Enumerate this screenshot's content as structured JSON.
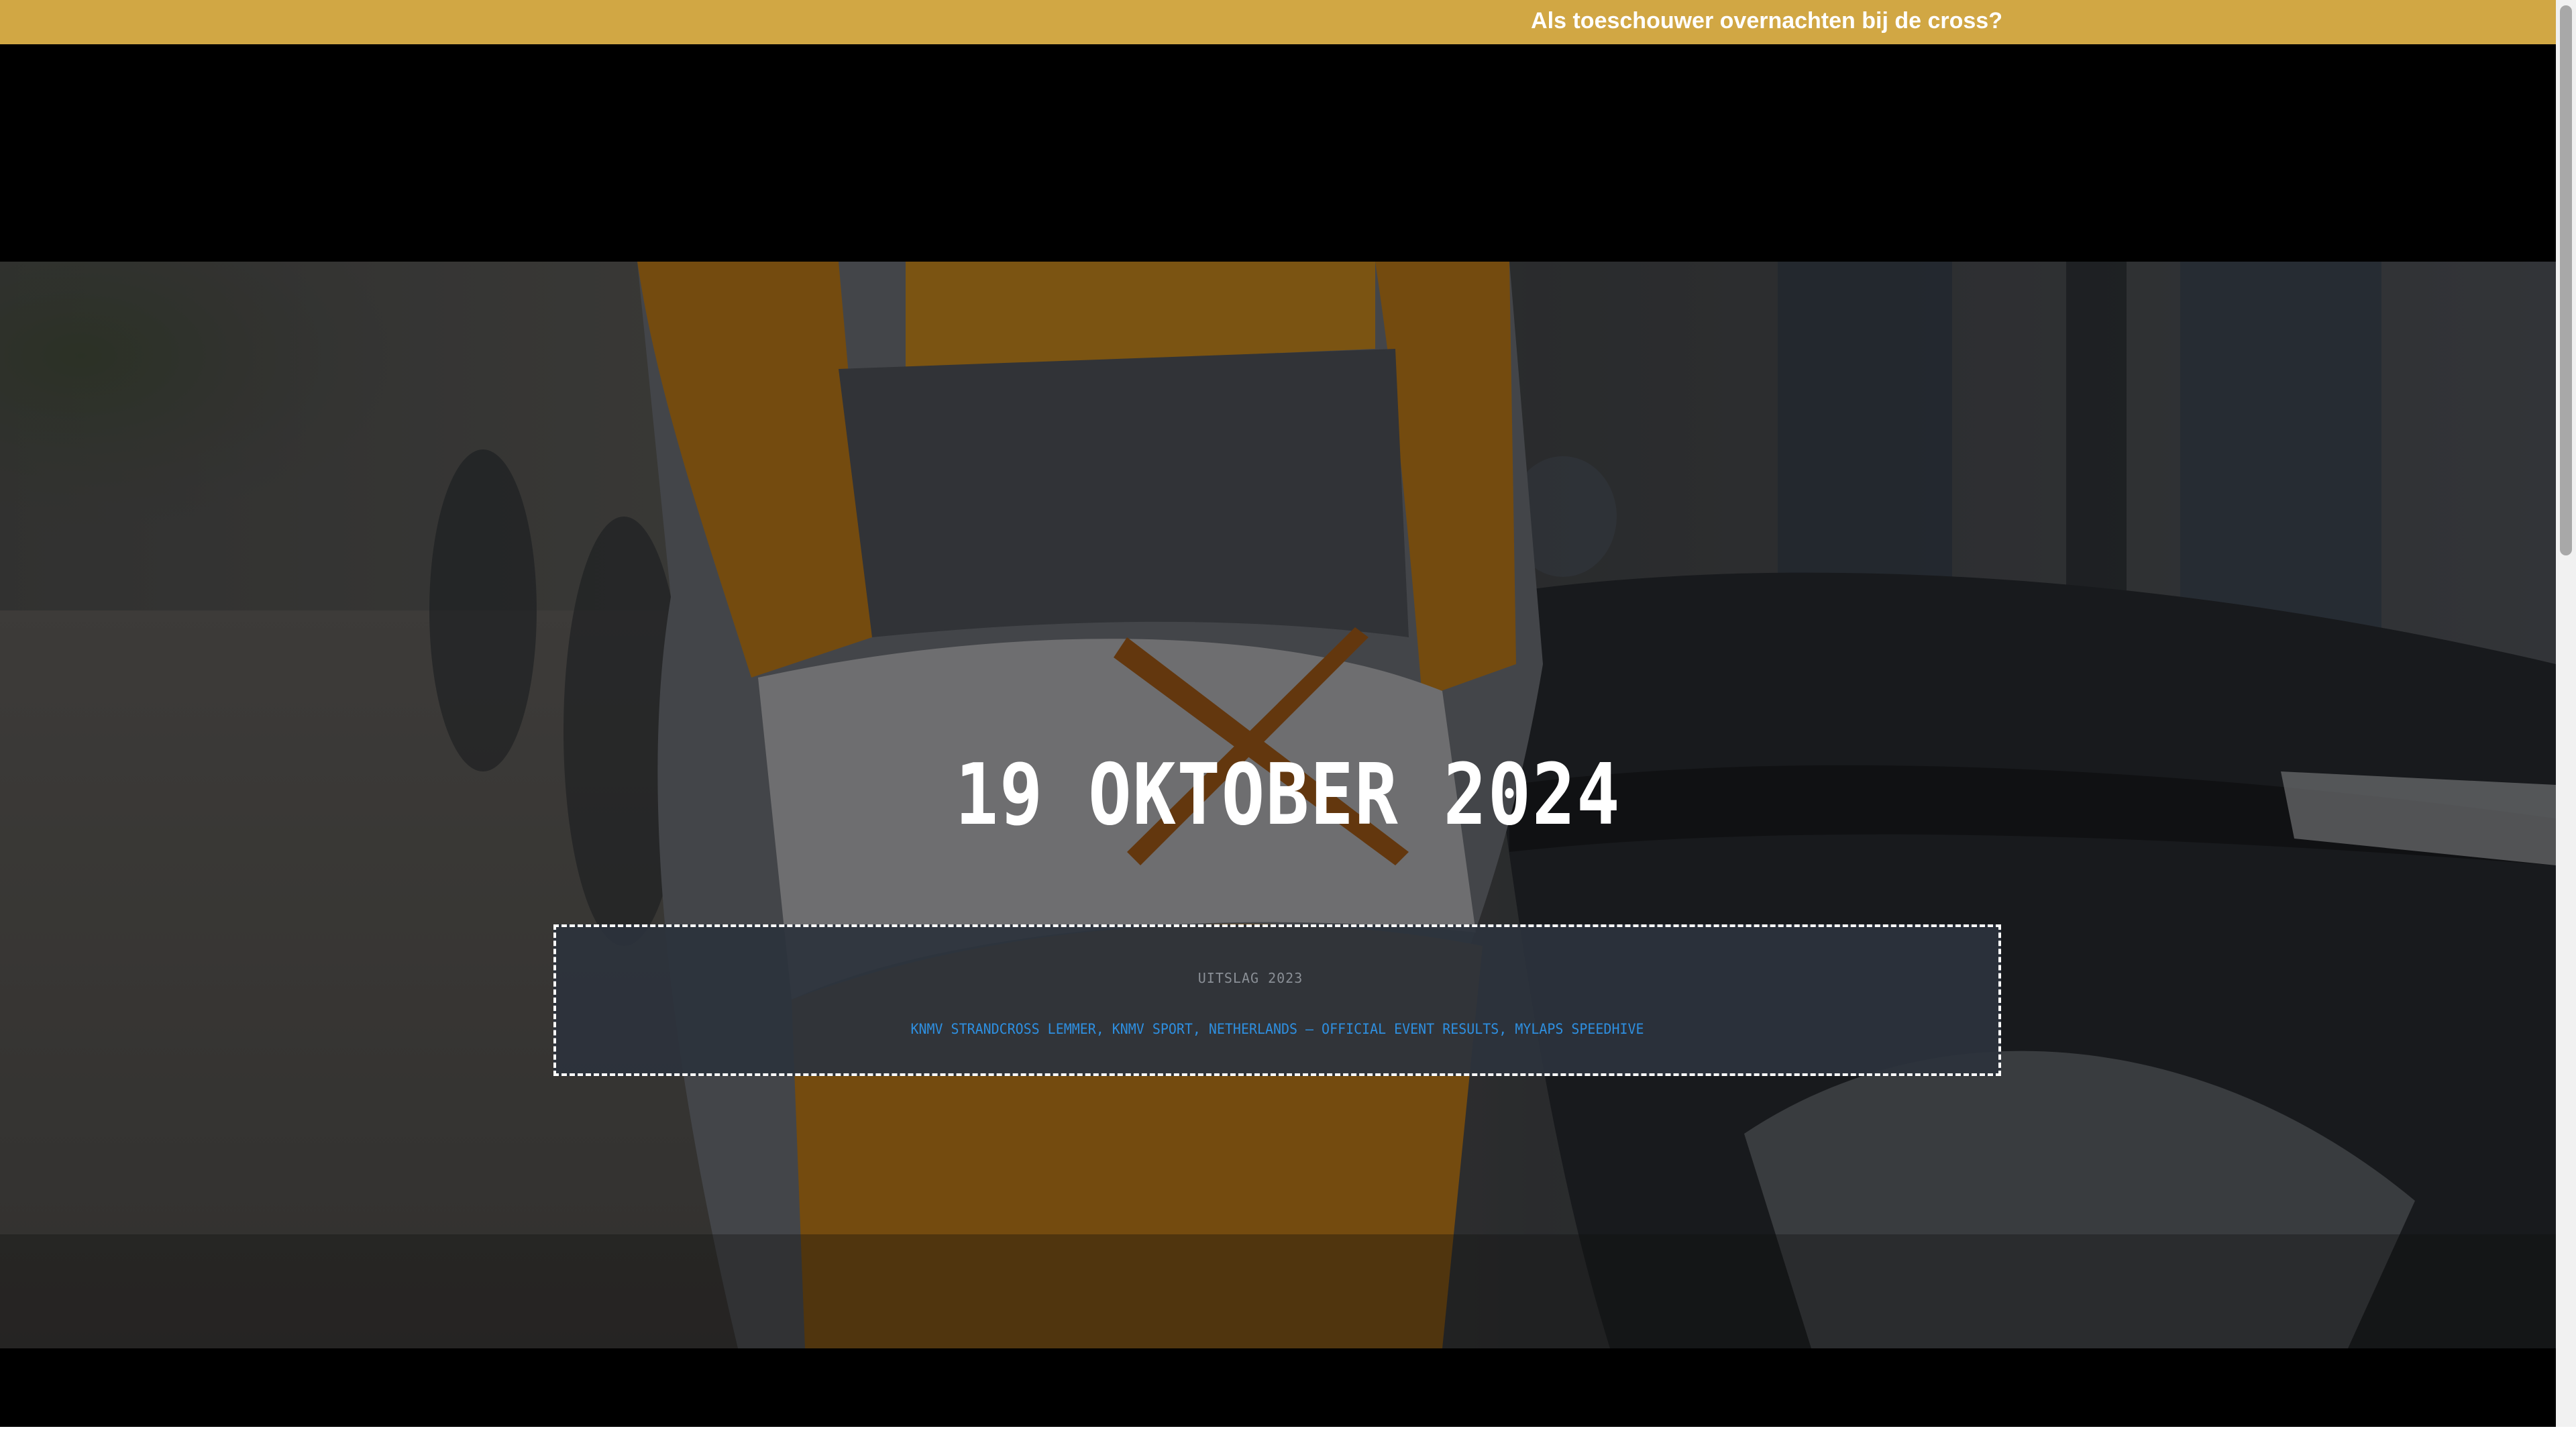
{
  "topbar": {
    "link_label": "Als toeschouwer overnachten bij de cross?",
    "background_color": "#d1a744"
  },
  "hero": {
    "date": "19 OKTOBER 2024",
    "photo_description_icon": "motocross-rider-photo"
  },
  "results": {
    "heading": "UITSLAG 2023",
    "link_label": "KNMV Strandcross Lemmer, KNMV Sport, Netherlands — Official Event Results, MYLAPS Speedhive",
    "link_color": "#2e8fe0"
  }
}
